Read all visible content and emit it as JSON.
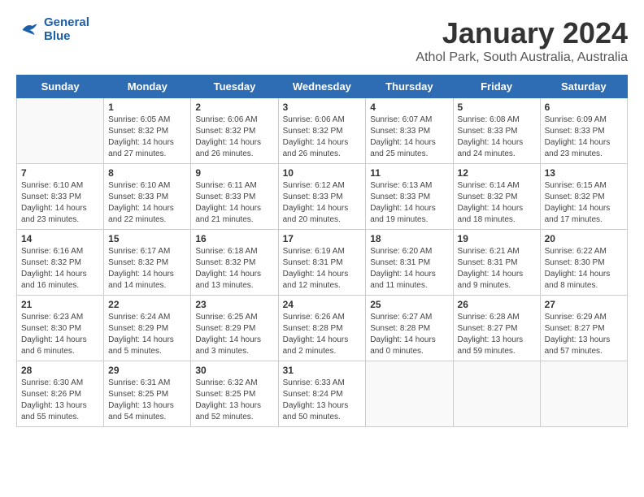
{
  "logo": {
    "general": "General",
    "blue": "Blue"
  },
  "header": {
    "month_year": "January 2024",
    "location": "Athol Park, South Australia, Australia"
  },
  "weekdays": [
    "Sunday",
    "Monday",
    "Tuesday",
    "Wednesday",
    "Thursday",
    "Friday",
    "Saturday"
  ],
  "weeks": [
    [
      {
        "day": "",
        "sunrise": "",
        "sunset": "",
        "daylight": ""
      },
      {
        "day": "1",
        "sunrise": "Sunrise: 6:05 AM",
        "sunset": "Sunset: 8:32 PM",
        "daylight": "Daylight: 14 hours and 27 minutes."
      },
      {
        "day": "2",
        "sunrise": "Sunrise: 6:06 AM",
        "sunset": "Sunset: 8:32 PM",
        "daylight": "Daylight: 14 hours and 26 minutes."
      },
      {
        "day": "3",
        "sunrise": "Sunrise: 6:06 AM",
        "sunset": "Sunset: 8:32 PM",
        "daylight": "Daylight: 14 hours and 26 minutes."
      },
      {
        "day": "4",
        "sunrise": "Sunrise: 6:07 AM",
        "sunset": "Sunset: 8:33 PM",
        "daylight": "Daylight: 14 hours and 25 minutes."
      },
      {
        "day": "5",
        "sunrise": "Sunrise: 6:08 AM",
        "sunset": "Sunset: 8:33 PM",
        "daylight": "Daylight: 14 hours and 24 minutes."
      },
      {
        "day": "6",
        "sunrise": "Sunrise: 6:09 AM",
        "sunset": "Sunset: 8:33 PM",
        "daylight": "Daylight: 14 hours and 23 minutes."
      }
    ],
    [
      {
        "day": "7",
        "sunrise": "Sunrise: 6:10 AM",
        "sunset": "Sunset: 8:33 PM",
        "daylight": "Daylight: 14 hours and 23 minutes."
      },
      {
        "day": "8",
        "sunrise": "Sunrise: 6:10 AM",
        "sunset": "Sunset: 8:33 PM",
        "daylight": "Daylight: 14 hours and 22 minutes."
      },
      {
        "day": "9",
        "sunrise": "Sunrise: 6:11 AM",
        "sunset": "Sunset: 8:33 PM",
        "daylight": "Daylight: 14 hours and 21 minutes."
      },
      {
        "day": "10",
        "sunrise": "Sunrise: 6:12 AM",
        "sunset": "Sunset: 8:33 PM",
        "daylight": "Daylight: 14 hours and 20 minutes."
      },
      {
        "day": "11",
        "sunrise": "Sunrise: 6:13 AM",
        "sunset": "Sunset: 8:33 PM",
        "daylight": "Daylight: 14 hours and 19 minutes."
      },
      {
        "day": "12",
        "sunrise": "Sunrise: 6:14 AM",
        "sunset": "Sunset: 8:32 PM",
        "daylight": "Daylight: 14 hours and 18 minutes."
      },
      {
        "day": "13",
        "sunrise": "Sunrise: 6:15 AM",
        "sunset": "Sunset: 8:32 PM",
        "daylight": "Daylight: 14 hours and 17 minutes."
      }
    ],
    [
      {
        "day": "14",
        "sunrise": "Sunrise: 6:16 AM",
        "sunset": "Sunset: 8:32 PM",
        "daylight": "Daylight: 14 hours and 16 minutes."
      },
      {
        "day": "15",
        "sunrise": "Sunrise: 6:17 AM",
        "sunset": "Sunset: 8:32 PM",
        "daylight": "Daylight: 14 hours and 14 minutes."
      },
      {
        "day": "16",
        "sunrise": "Sunrise: 6:18 AM",
        "sunset": "Sunset: 8:32 PM",
        "daylight": "Daylight: 14 hours and 13 minutes."
      },
      {
        "day": "17",
        "sunrise": "Sunrise: 6:19 AM",
        "sunset": "Sunset: 8:31 PM",
        "daylight": "Daylight: 14 hours and 12 minutes."
      },
      {
        "day": "18",
        "sunrise": "Sunrise: 6:20 AM",
        "sunset": "Sunset: 8:31 PM",
        "daylight": "Daylight: 14 hours and 11 minutes."
      },
      {
        "day": "19",
        "sunrise": "Sunrise: 6:21 AM",
        "sunset": "Sunset: 8:31 PM",
        "daylight": "Daylight: 14 hours and 9 minutes."
      },
      {
        "day": "20",
        "sunrise": "Sunrise: 6:22 AM",
        "sunset": "Sunset: 8:30 PM",
        "daylight": "Daylight: 14 hours and 8 minutes."
      }
    ],
    [
      {
        "day": "21",
        "sunrise": "Sunrise: 6:23 AM",
        "sunset": "Sunset: 8:30 PM",
        "daylight": "Daylight: 14 hours and 6 minutes."
      },
      {
        "day": "22",
        "sunrise": "Sunrise: 6:24 AM",
        "sunset": "Sunset: 8:29 PM",
        "daylight": "Daylight: 14 hours and 5 minutes."
      },
      {
        "day": "23",
        "sunrise": "Sunrise: 6:25 AM",
        "sunset": "Sunset: 8:29 PM",
        "daylight": "Daylight: 14 hours and 3 minutes."
      },
      {
        "day": "24",
        "sunrise": "Sunrise: 6:26 AM",
        "sunset": "Sunset: 8:28 PM",
        "daylight": "Daylight: 14 hours and 2 minutes."
      },
      {
        "day": "25",
        "sunrise": "Sunrise: 6:27 AM",
        "sunset": "Sunset: 8:28 PM",
        "daylight": "Daylight: 14 hours and 0 minutes."
      },
      {
        "day": "26",
        "sunrise": "Sunrise: 6:28 AM",
        "sunset": "Sunset: 8:27 PM",
        "daylight": "Daylight: 13 hours and 59 minutes."
      },
      {
        "day": "27",
        "sunrise": "Sunrise: 6:29 AM",
        "sunset": "Sunset: 8:27 PM",
        "daylight": "Daylight: 13 hours and 57 minutes."
      }
    ],
    [
      {
        "day": "28",
        "sunrise": "Sunrise: 6:30 AM",
        "sunset": "Sunset: 8:26 PM",
        "daylight": "Daylight: 13 hours and 55 minutes."
      },
      {
        "day": "29",
        "sunrise": "Sunrise: 6:31 AM",
        "sunset": "Sunset: 8:25 PM",
        "daylight": "Daylight: 13 hours and 54 minutes."
      },
      {
        "day": "30",
        "sunrise": "Sunrise: 6:32 AM",
        "sunset": "Sunset: 8:25 PM",
        "daylight": "Daylight: 13 hours and 52 minutes."
      },
      {
        "day": "31",
        "sunrise": "Sunrise: 6:33 AM",
        "sunset": "Sunset: 8:24 PM",
        "daylight": "Daylight: 13 hours and 50 minutes."
      },
      {
        "day": "",
        "sunrise": "",
        "sunset": "",
        "daylight": ""
      },
      {
        "day": "",
        "sunrise": "",
        "sunset": "",
        "daylight": ""
      },
      {
        "day": "",
        "sunrise": "",
        "sunset": "",
        "daylight": ""
      }
    ]
  ]
}
